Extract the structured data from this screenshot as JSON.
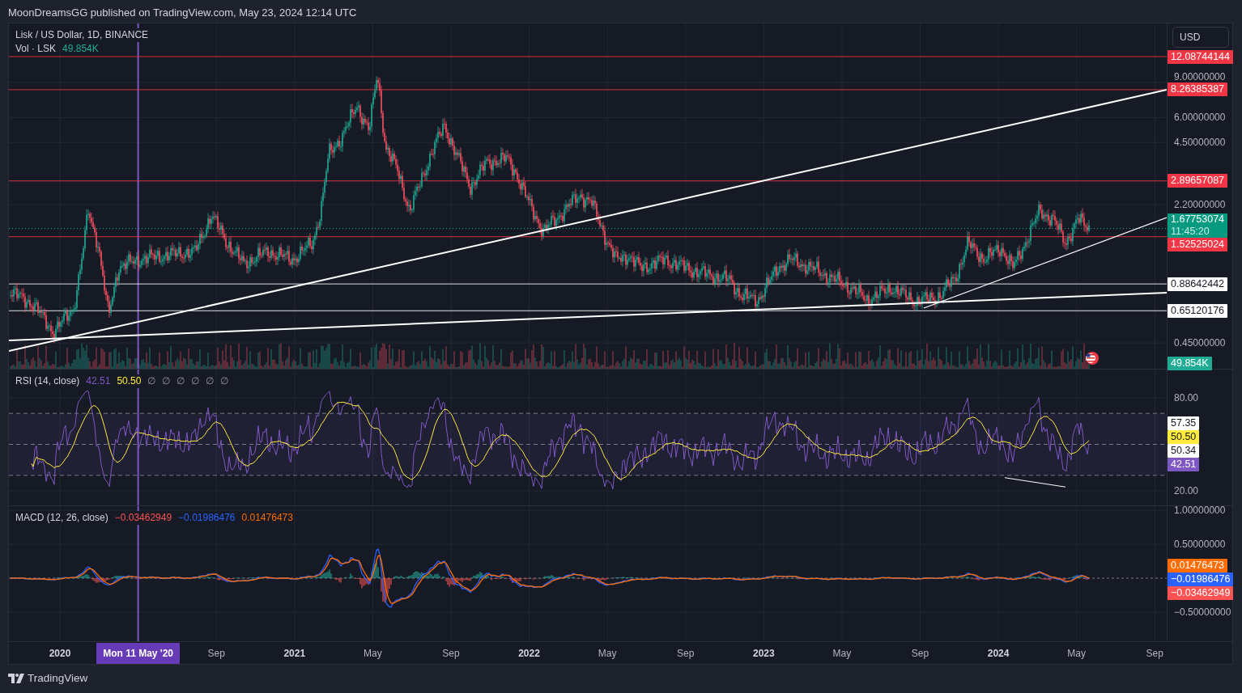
{
  "header": {
    "text": "MoonDreamsGG published on TradingView.com, May 23, 2024 12:14 UTC"
  },
  "currency_button": "USD",
  "price_pane": {
    "legend": {
      "symbol": "Lisk / US Dollar, 1D, BINANCE",
      "volume_label": "Vol · LSK",
      "volume_value": "49.854K"
    },
    "axis_ticks": [
      "9.00000000",
      "6.00000000",
      "4.50000000",
      "2.20000000",
      "0.45000000"
    ],
    "levels": [
      {
        "label": "12.08744144",
        "color": "#f23645"
      },
      {
        "label": "8.26385387",
        "color": "#f23645"
      },
      {
        "label": "2.89657087",
        "color": "#f23645"
      },
      {
        "label": "1.52525024",
        "color": "#f23645"
      },
      {
        "label": "0.88642442",
        "color": "#ffffff"
      },
      {
        "label": "0.65120176",
        "color": "#ffffff"
      }
    ],
    "current_price": {
      "label": "1.67753074",
      "countdown": "11:45:20"
    },
    "volume_marker": "49.854K"
  },
  "rsi_pane": {
    "legend": {
      "title": "RSI (14, close)",
      "rsi_value": "42.51",
      "ma_value": "50.50",
      "hidden_values": [
        "∅",
        "∅",
        "∅",
        "∅",
        "∅",
        "∅"
      ]
    },
    "axis_ticks": [
      "80.00",
      "20.00"
    ],
    "markers": [
      {
        "label": "57.35",
        "color": "#ffffff"
      },
      {
        "label": "50.50",
        "color": "#ffeb3b"
      },
      {
        "label": "50.34",
        "color": "#ffffff"
      },
      {
        "label": "42.51",
        "color": "#7e57c2"
      }
    ]
  },
  "macd_pane": {
    "legend": {
      "title": "MACD (12, 26, close)",
      "histogram_value": "−0.03462949",
      "macd_value": "−0.01986476",
      "signal_value": "0.01476473"
    },
    "axis_ticks": [
      "1.00000000",
      "0.50000000",
      "−0.50000000"
    ],
    "markers": [
      {
        "label": "0.01476473",
        "color": "#ff6d00"
      },
      {
        "label": "−0.01986476",
        "color": "#2962ff"
      },
      {
        "label": "−0.03462949",
        "color": "#ff5252"
      }
    ]
  },
  "time_axis": [
    {
      "label": "2020",
      "kind": "year"
    },
    {
      "label": "Mon 11 May '20",
      "kind": "crosshair"
    },
    {
      "label": "Sep",
      "kind": "month"
    },
    {
      "label": "2021",
      "kind": "year"
    },
    {
      "label": "May",
      "kind": "month"
    },
    {
      "label": "Sep",
      "kind": "month"
    },
    {
      "label": "2022",
      "kind": "year"
    },
    {
      "label": "May",
      "kind": "month"
    },
    {
      "label": "Sep",
      "kind": "month"
    },
    {
      "label": "2023",
      "kind": "year"
    },
    {
      "label": "May",
      "kind": "month"
    },
    {
      "label": "Sep",
      "kind": "month"
    },
    {
      "label": "2024",
      "kind": "year"
    },
    {
      "label": "May",
      "kind": "month"
    },
    {
      "label": "Sep",
      "kind": "month"
    }
  ],
  "footer": {
    "brand": "TradingView"
  }
}
